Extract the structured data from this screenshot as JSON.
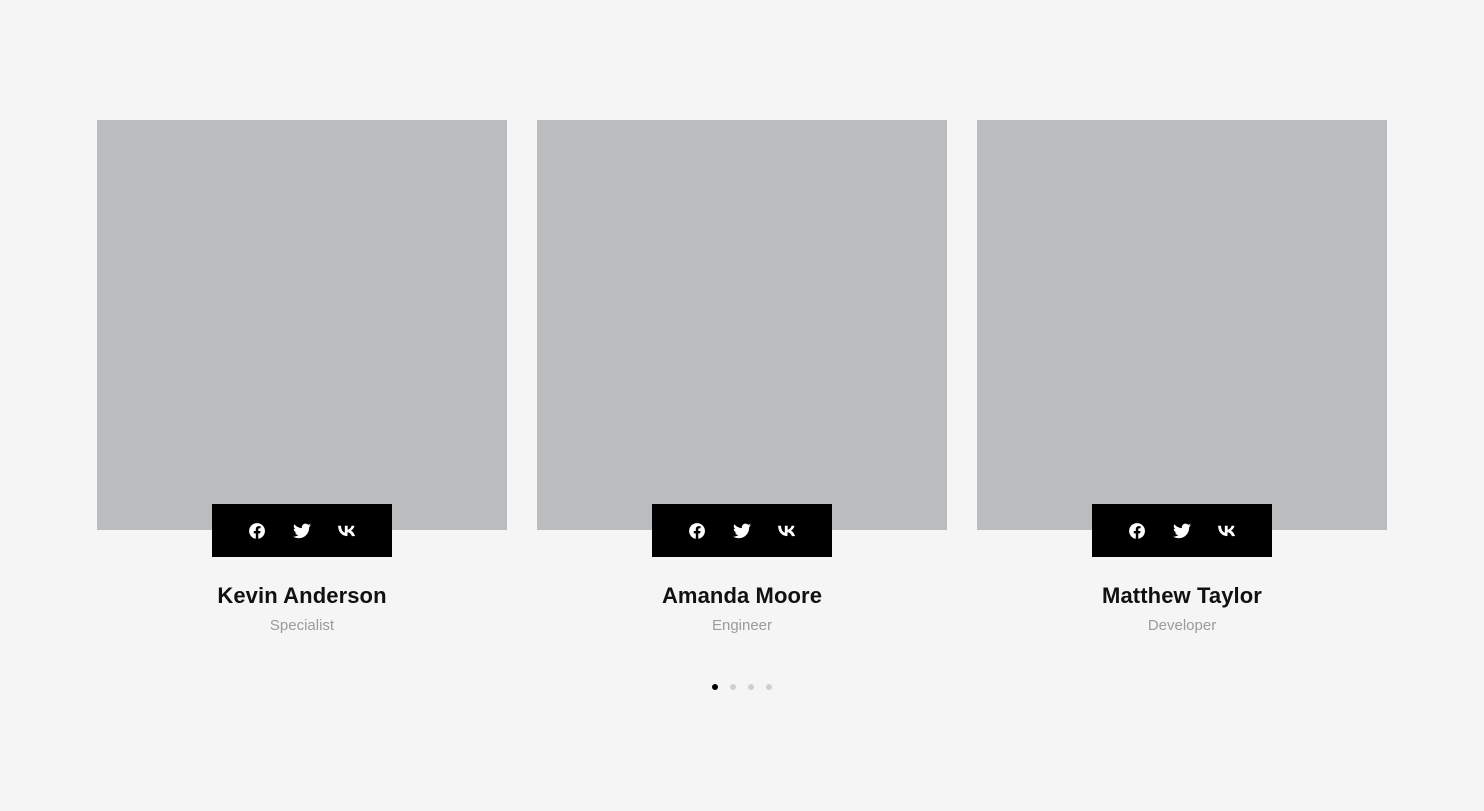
{
  "members": [
    {
      "name": "Kevin Anderson",
      "role": "Specialist"
    },
    {
      "name": "Amanda Moore",
      "role": "Engineer"
    },
    {
      "name": "Matthew Taylor",
      "role": "Developer"
    }
  ],
  "social_icons": [
    "facebook-icon",
    "twitter-icon",
    "vk-icon"
  ],
  "pagination": {
    "total_pages": 4,
    "active_page": 1
  },
  "colors": {
    "page_background": "#f5f5f5",
    "photo_placeholder": "#bbbcbe",
    "social_bar": "#000000",
    "name_text": "#111111",
    "role_text": "#9b9b9b",
    "dot_active": "#000000",
    "dot_inactive": "#cfcfcf"
  }
}
